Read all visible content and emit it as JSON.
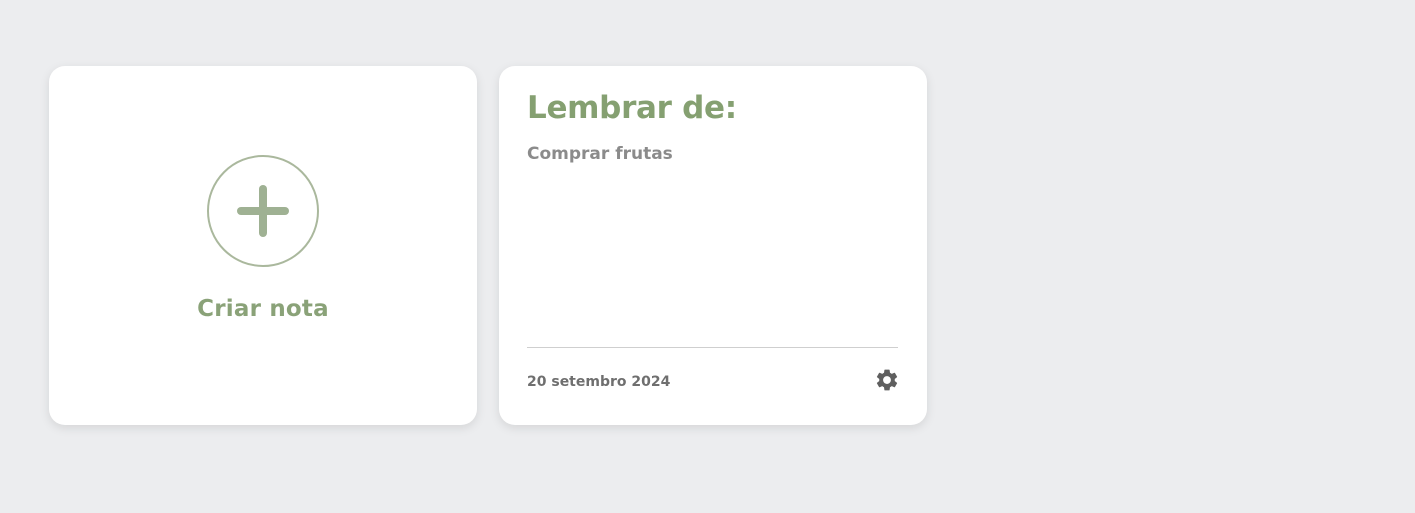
{
  "create_card": {
    "icon": "plus-icon",
    "label": "Criar nota",
    "accent_color": "#8aa278",
    "circle_color": "#aab89d"
  },
  "notes": [
    {
      "title": "Lembrar de:",
      "body": "Comprar frutas",
      "date": "20 setembro 2024",
      "settings_icon": "gear-icon"
    }
  ],
  "colors": {
    "background": "#ecedef",
    "card": "#ffffff",
    "title": "#85a071",
    "icon_gray": "#5f5f5f"
  }
}
